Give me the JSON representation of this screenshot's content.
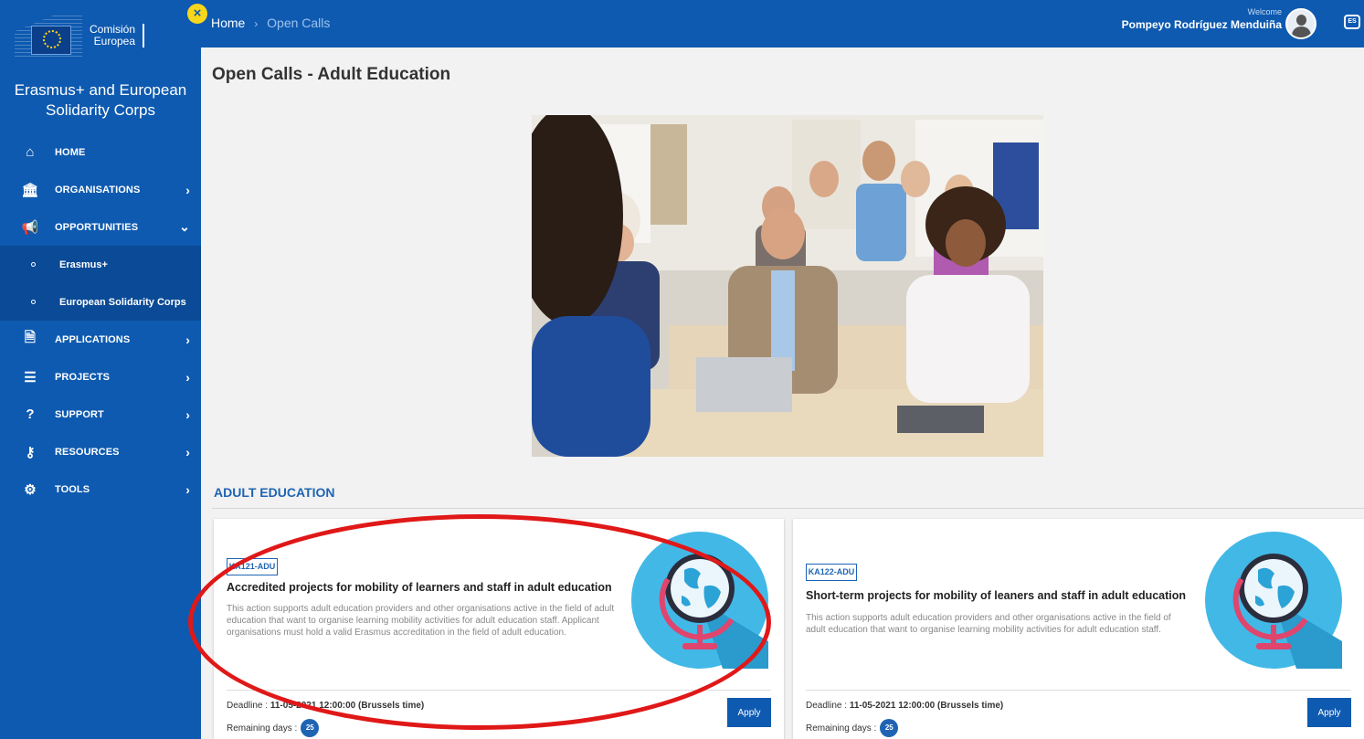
{
  "logo": {
    "line1": "Comisión",
    "line2": "Europea"
  },
  "close_badge": "×",
  "app_title": "Erasmus+ and European Solidarity Corps",
  "sidebar": {
    "items": [
      {
        "label": "HOME",
        "icon": "home-icon",
        "glyph": "⌂"
      },
      {
        "label": "ORGANISATIONS",
        "icon": "bank-icon",
        "glyph": "🏛",
        "chevron": "›"
      },
      {
        "label": "OPPORTUNITIES",
        "icon": "megaphone-icon",
        "glyph": "📢",
        "chevron": "⌄"
      },
      {
        "label": "APPLICATIONS",
        "icon": "document-icon",
        "glyph": "🗎",
        "chevron": "›"
      },
      {
        "label": "PROJECTS",
        "icon": "list-icon",
        "glyph": "☰",
        "chevron": "›"
      },
      {
        "label": "SUPPORT",
        "icon": "question-icon",
        "glyph": "?",
        "chevron": "›"
      },
      {
        "label": "RESOURCES",
        "icon": "key-icon",
        "glyph": "⚷",
        "chevron": "›"
      },
      {
        "label": "TOOLS",
        "icon": "gears-icon",
        "glyph": "⚙",
        "chevron": "›"
      }
    ],
    "subitems": [
      {
        "label": "Erasmus+"
      },
      {
        "label": "European Solidarity Corps"
      }
    ]
  },
  "breadcrumb": {
    "home": "Home",
    "separator": "›",
    "current": "Open Calls"
  },
  "user": {
    "welcome": "Welcome",
    "name": "Pompeyo Rodríguez Menduiña"
  },
  "language": "ES",
  "page_title": "Open Calls - Adult Education",
  "section_title": "ADULT EDUCATION",
  "cards": [
    {
      "tag": "KA121-ADU",
      "title": "Accredited projects for mobility of learners and staff in adult education",
      "description": "This action supports adult education providers and other organisations active in the field of adult education that want to organise learning mobility activities for adult education staff. Applicant organisations must hold a valid Erasmus accreditation in the field of adult education.",
      "deadline_label": "Deadline : ",
      "deadline_value": "11-05-2021 12:00:00 (Brussels time)",
      "remaining_label": "Remaining days :",
      "remaining_days": "25",
      "apply_label": "Apply"
    },
    {
      "tag": "KA122-ADU",
      "title": "Short-term projects for mobility of leaners and staff in adult education",
      "description": "This action supports adult education providers and other organisations active in the field of adult education that want to organise learning mobility activities for adult education staff.",
      "deadline_label": "Deadline : ",
      "deadline_value": "11-05-2021 12:00:00 (Brussels time)",
      "remaining_label": "Remaining days :",
      "remaining_days": "25",
      "apply_label": "Apply"
    }
  ],
  "colors": {
    "primary": "#0e5ab0",
    "accent": "#1f64b3",
    "annotation": "#e01818",
    "badge": "#f7d71b"
  }
}
